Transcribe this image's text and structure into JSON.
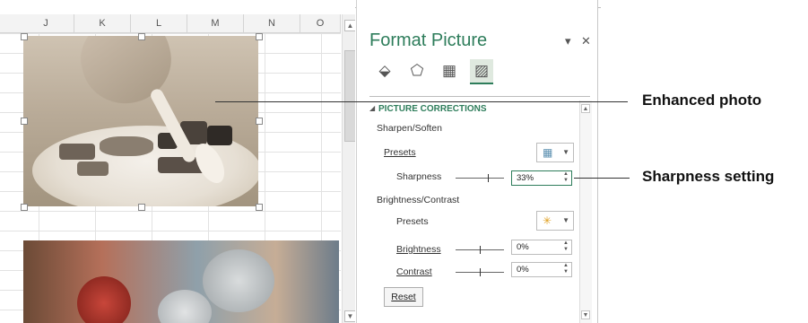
{
  "spreadsheet": {
    "columns": [
      "J",
      "K",
      "L",
      "M",
      "N",
      "O"
    ]
  },
  "format_pane": {
    "title": "Format Picture",
    "dropdown_glyph": "▾",
    "close_glyph": "✕",
    "tabs": [
      {
        "icon": "fill-line-icon",
        "glyph": "⬙"
      },
      {
        "icon": "effects-pentagon-icon",
        "glyph": "⬠"
      },
      {
        "icon": "size-properties-icon",
        "glyph": "▦"
      },
      {
        "icon": "picture-icon",
        "glyph": "▨",
        "active": true
      }
    ],
    "section": "PICTURE CORRECTIONS",
    "sharpen": {
      "heading": "Sharpen/Soften",
      "presets_label": "Presets",
      "sharpness_label": "Sharpness",
      "sharpness_value": "33%",
      "sharpness_level": 0.66
    },
    "brightness_contrast": {
      "heading": "Brightness/Contrast",
      "presets_label": "Presets",
      "brightness_label": "Brightness",
      "brightness_value": "0%",
      "brightness_level": 0.5,
      "contrast_label": "Contrast",
      "contrast_value": "0%",
      "contrast_level": 0.5
    },
    "reset_label": "Reset"
  },
  "callouts": {
    "enhanced_photo": "Enhanced photo",
    "sharpness_setting": "Sharpness setting"
  },
  "colors": {
    "accent": "#2e7d5b"
  }
}
